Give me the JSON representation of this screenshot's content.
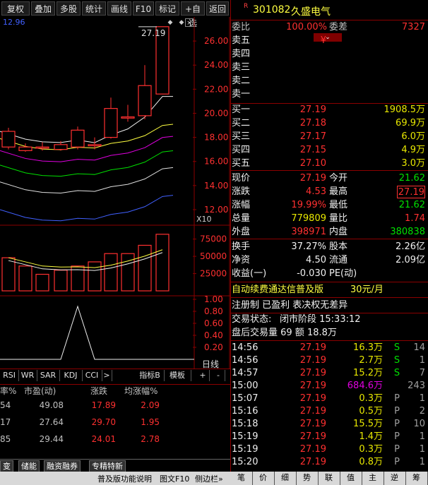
{
  "toolbar": {
    "items": [
      "复权",
      "叠加",
      "多股",
      "统计",
      "画线",
      "F10",
      "标记",
      "+自选",
      "返回"
    ]
  },
  "chart_top": {
    "ma_label": "12.96",
    "peak_label": "27.19",
    "y_ticks": [
      "26.00",
      "24.00",
      "22.00",
      "20.00",
      "18.00",
      "16.00",
      "14.00",
      "12.00"
    ],
    "vol_ticks": [
      "75000",
      "50000",
      "25000"
    ],
    "vol_unit": "X10",
    "ind_ticks": [
      "1.00",
      "0.80",
      "0.60",
      "0.40",
      "0.20"
    ],
    "period": "日线"
  },
  "chart_data": [
    {
      "type": "candlestick",
      "ylim": [
        11,
        28
      ],
      "candles": [
        {
          "o": 17.2,
          "c": 18.5,
          "h": 18.8,
          "l": 17.0
        },
        {
          "o": 16.9,
          "c": 17.2,
          "h": 17.5,
          "l": 16.8
        },
        {
          "o": 17.1,
          "c": 17.2,
          "h": 17.6,
          "l": 16.9
        },
        {
          "o": 17.0,
          "c": 17.4,
          "h": 17.7,
          "l": 16.9
        },
        {
          "o": 17.2,
          "c": 18.6,
          "h": 18.9,
          "l": 17.0
        },
        {
          "o": 17.3,
          "c": 17.4,
          "h": 18.0,
          "l": 17.0
        },
        {
          "o": 18.0,
          "c": 20.4,
          "h": 21.3,
          "l": 17.9
        },
        {
          "o": 19.6,
          "c": 19.7,
          "h": 20.7,
          "l": 19.3
        },
        {
          "o": 19.8,
          "c": 22.3,
          "h": 24.0,
          "l": 19.5
        },
        {
          "o": 21.6,
          "c": 27.19,
          "h": 27.19,
          "l": 21.6
        }
      ]
    },
    {
      "type": "bar",
      "ylim": [
        0,
        90000
      ],
      "values": [
        48000,
        36000,
        24000,
        30000,
        36000,
        42000,
        54000,
        54000,
        66000,
        82000
      ]
    }
  ],
  "tabs_ind": [
    "RSI",
    "WR",
    "SAR",
    "KDJ",
    "CCI",
    ">",
    "指标B",
    "模板",
    "+",
    "-"
  ],
  "table": {
    "headers": [
      "率%",
      "市盈(动)",
      "涨跌",
      "均涨幅%"
    ],
    "rows": [
      [
        "54",
        "49.08",
        "17.89",
        "2.09"
      ],
      [
        "17",
        "27.64",
        "29.70",
        "1.95"
      ],
      [
        "85",
        "29.44",
        "24.01",
        "2.78"
      ]
    ]
  },
  "bottom_tabs": [
    "变",
    "储能",
    "融资融券",
    "专精特新"
  ],
  "bottom_bar": [
    "普及版功能说明",
    "图文F10",
    "侧边栏»"
  ],
  "stock": {
    "r_badge": "R",
    "code": "301082",
    "name": "久盛电气",
    "webi_label": "委比",
    "webi_value": "100.00%",
    "weicha_label": "委差",
    "weicha_value": "7327",
    "sell": [
      {
        "label": "卖五",
        "price": "¥",
        "vol": ""
      },
      {
        "label": "卖四",
        "price": "",
        "vol": ""
      },
      {
        "label": "卖三",
        "price": "",
        "vol": ""
      },
      {
        "label": "卖二",
        "price": "",
        "vol": ""
      },
      {
        "label": "卖一",
        "price": "",
        "vol": ""
      }
    ],
    "buy": [
      {
        "label": "买一",
        "price": "27.19",
        "vol": "1908.5万"
      },
      {
        "label": "买二",
        "price": "27.18",
        "vol": "69.9万"
      },
      {
        "label": "买三",
        "price": "27.17",
        "vol": "6.0万"
      },
      {
        "label": "买四",
        "price": "27.15",
        "vol": "4.9万"
      },
      {
        "label": "买五",
        "price": "27.10",
        "vol": "3.0万"
      }
    ],
    "stats": [
      {
        "l1": "现价",
        "v1": "27.19",
        "l2": "今开",
        "v2": "21.62",
        "c1": "red",
        "c2": "green"
      },
      {
        "l1": "涨跌",
        "v1": "4.53",
        "l2": "最高",
        "v2": "27.19",
        "c1": "red",
        "c2": "red"
      },
      {
        "l1": "涨幅",
        "v1": "19.99%",
        "l2": "最低",
        "v2": "21.62",
        "c1": "red",
        "c2": "green"
      },
      {
        "l1": "总量",
        "v1": "779809",
        "l2": "量比",
        "v2": "1.74",
        "c1": "yellow",
        "c2": "red"
      },
      {
        "l1": "外盘",
        "v1": "398971",
        "l2": "内盘",
        "v2": "380838",
        "c1": "red",
        "c2": "green"
      }
    ],
    "stats2": [
      {
        "l1": "换手",
        "v1": "37.27%",
        "l2": "股本",
        "v2": "2.26亿"
      },
      {
        "l1": "净资",
        "v1": "4.50",
        "l2": "流通",
        "v2": "2.09亿"
      },
      {
        "l1": "收益(一)",
        "v1": "-0.030",
        "l2": "PE(动)",
        "v2": ""
      }
    ],
    "promo": "自动续费通达信普及版",
    "promo_price": "30元/月",
    "info1": "注册制 已盈利 表决权无差异",
    "info2_label": "交易状态:",
    "info2_value": "闭市阶段 15:33:12",
    "info3": "盘后交易量 69 额 18.8万"
  },
  "ticks": [
    {
      "t": "14:56",
      "p": "27.19",
      "v": "16.3万",
      "s": "S",
      "n": "14",
      "vc": "yellow",
      "sc": "green"
    },
    {
      "t": "14:56",
      "p": "27.19",
      "v": "2.7万",
      "s": "S",
      "n": "1",
      "vc": "yellow",
      "sc": "green"
    },
    {
      "t": "14:57",
      "p": "27.19",
      "v": "15.2万",
      "s": "S",
      "n": "7",
      "vc": "yellow",
      "sc": "green"
    },
    {
      "t": "15:00",
      "p": "27.19",
      "v": "684.6万",
      "s": "",
      "n": "243",
      "vc": "mag",
      "sc": "gray"
    },
    {
      "t": "15:07",
      "p": "27.19",
      "v": "0.3万",
      "s": "P",
      "n": "1",
      "vc": "yellow",
      "sc": "gray"
    },
    {
      "t": "15:16",
      "p": "27.19",
      "v": "0.5万",
      "s": "P",
      "n": "2",
      "vc": "yellow",
      "sc": "gray"
    },
    {
      "t": "15:18",
      "p": "27.19",
      "v": "15.5万",
      "s": "P",
      "n": "10",
      "vc": "yellow",
      "sc": "gray"
    },
    {
      "t": "15:19",
      "p": "27.19",
      "v": "1.4万",
      "s": "P",
      "n": "1",
      "vc": "yellow",
      "sc": "gray"
    },
    {
      "t": "15:19",
      "p": "27.19",
      "v": "0.3万",
      "s": "P",
      "n": "1",
      "vc": "yellow",
      "sc": "gray"
    },
    {
      "t": "15:20",
      "p": "27.19",
      "v": "0.8万",
      "s": "P",
      "n": "1",
      "vc": "yellow",
      "sc": "gray"
    }
  ],
  "right_bottom_tabs": [
    "笔",
    "价",
    "细",
    "势",
    "联",
    "值",
    "主",
    "逆",
    "筹"
  ]
}
